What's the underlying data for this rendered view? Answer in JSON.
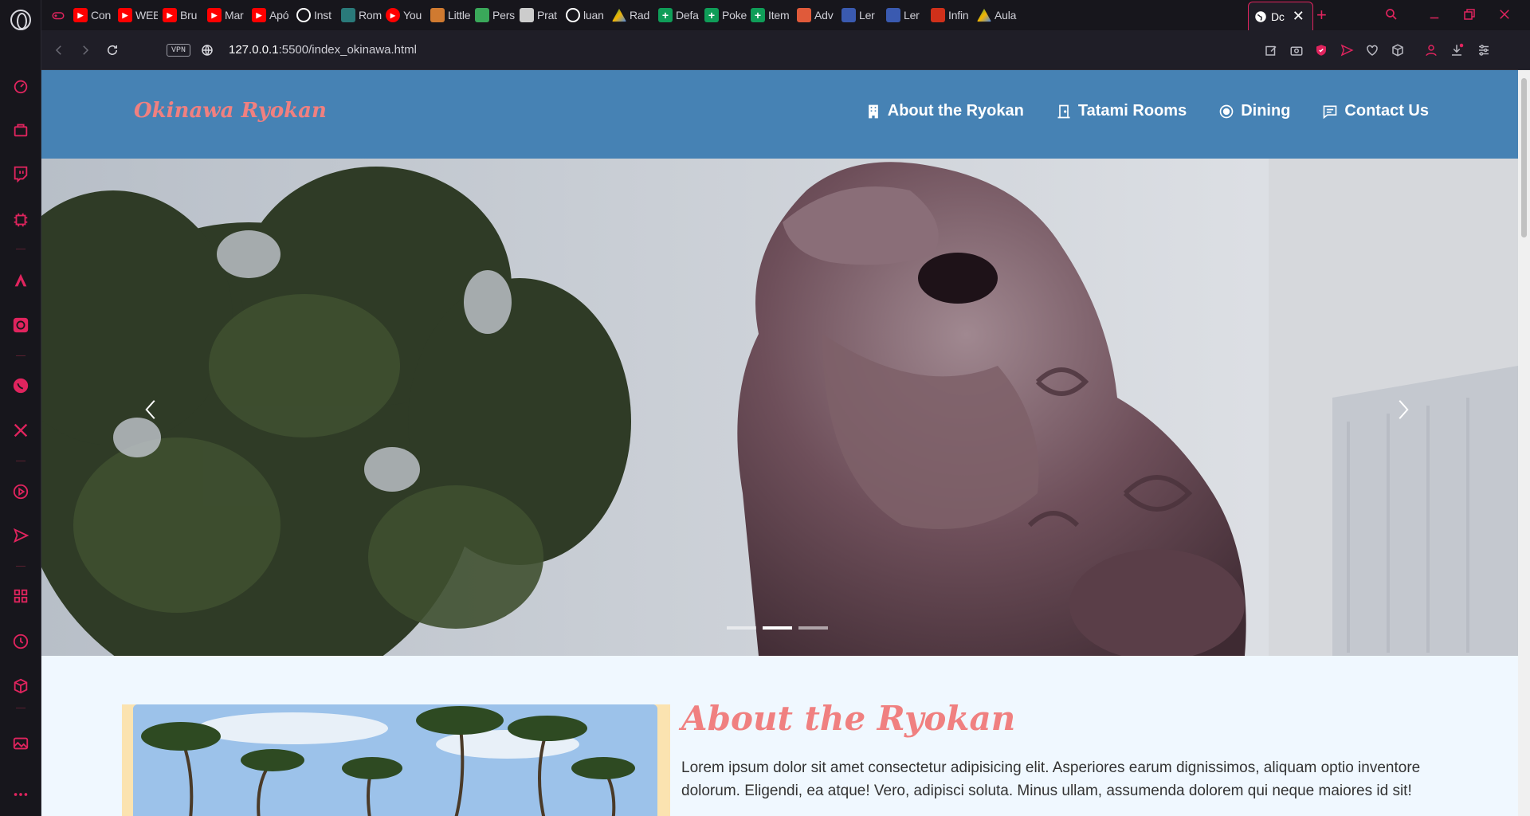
{
  "browser": {
    "tabs": [
      {
        "title": "Con",
        "icon": "youtube-icon",
        "color": "#ff0000"
      },
      {
        "title": "WEB",
        "icon": "youtube-icon",
        "color": "#ff0000"
      },
      {
        "title": "Bru",
        "icon": "youtube-icon",
        "color": "#ff0000"
      },
      {
        "title": "Mar",
        "icon": "youtube-icon",
        "color": "#ff0000"
      },
      {
        "title": "Apó",
        "icon": "youtube-icon",
        "color": "#ff0000"
      },
      {
        "title": "Inst",
        "icon": "github-icon",
        "color": "#ffffff"
      },
      {
        "title": "Rom",
        "icon": "site-icon",
        "color": "#2a7a7a"
      },
      {
        "title": "You",
        "icon": "youtube-music-icon",
        "color": "#ff0000"
      },
      {
        "title": "Little",
        "icon": "site-icon",
        "color": "#d07a30"
      },
      {
        "title": "Pers",
        "icon": "site-icon",
        "color": "#3aa85a"
      },
      {
        "title": "Prat",
        "icon": "site-icon",
        "color": "#cccccc"
      },
      {
        "title": "luan",
        "icon": "github-icon",
        "color": "#ffffff"
      },
      {
        "title": "Rad",
        "icon": "google-drive-icon",
        "color": "#f4b400"
      },
      {
        "title": "Defa",
        "icon": "sheets-icon",
        "color": "#0f9d58"
      },
      {
        "title": "Poke",
        "icon": "sheets-icon",
        "color": "#0f9d58"
      },
      {
        "title": "Item",
        "icon": "sheets-icon",
        "color": "#0f9d58"
      },
      {
        "title": "Adv",
        "icon": "site-icon",
        "color": "#e05a3a"
      },
      {
        "title": "Ler",
        "icon": "site-icon",
        "color": "#3a5ab0"
      },
      {
        "title": "Ler",
        "icon": "site-icon",
        "color": "#3a5ab0"
      },
      {
        "title": "Infin",
        "icon": "site-icon",
        "color": "#d0301a"
      },
      {
        "title": "Aula",
        "icon": "google-drive-icon",
        "color": "#f4b400"
      }
    ],
    "active_tab": {
      "title": "Dc",
      "icon": "globe-icon"
    },
    "url_host": "127.0.0.1",
    "url_rest": ":5500/index_okinawa.html",
    "vpn_label": "VPN",
    "accent": "#e0245e"
  },
  "site": {
    "brand": "Okinawa Ryokan",
    "nav": [
      {
        "label": "About the Ryokan",
        "icon": "building-icon"
      },
      {
        "label": "Tatami Rooms",
        "icon": "door-icon"
      },
      {
        "label": "Dining",
        "icon": "plate-icon"
      },
      {
        "label": "Contact Us",
        "icon": "chat-icon"
      }
    ],
    "carousel": {
      "slides": 3,
      "active_index": 1
    },
    "about": {
      "title": "About the Ryokan",
      "text": "Lorem ipsum dolor sit amet consectetur adipisicing elit. Asperiores earum dignissimos, aliquam optio inventore dolorum. Eligendi, ea atque! Vero, adipisci soluta. Minus ullam, assumenda dolorem qui neque maiores id sit!"
    },
    "colors": {
      "navbar": "#4682b4",
      "brand": "#f08080",
      "page_bg": "#f0f8ff"
    }
  }
}
